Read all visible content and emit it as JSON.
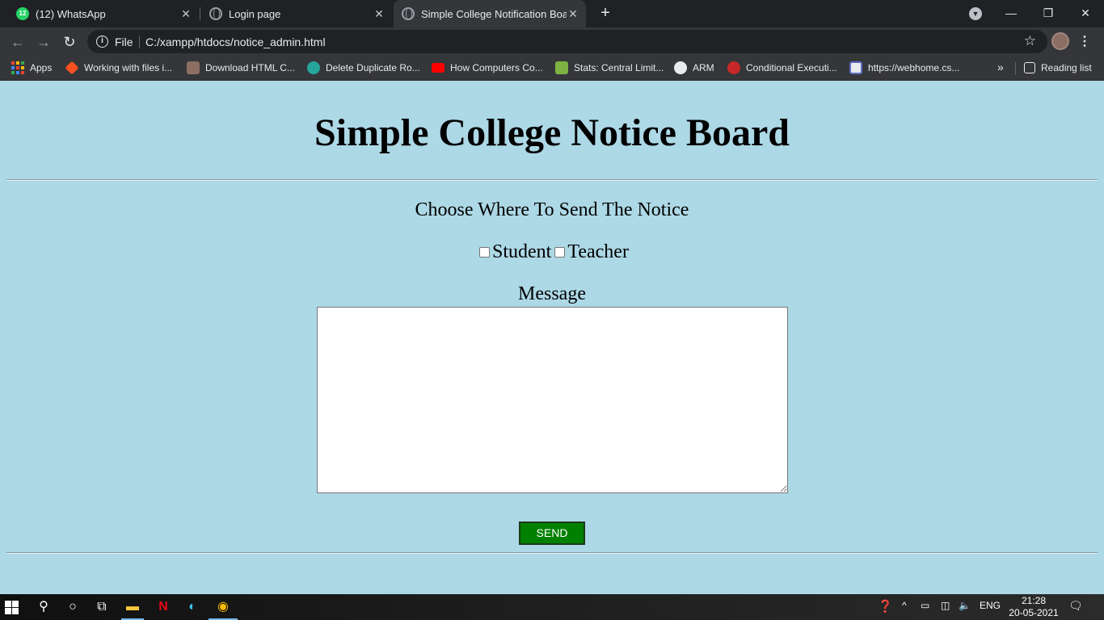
{
  "browser": {
    "tabs": [
      {
        "title": "(12) WhatsApp",
        "badge": "12"
      },
      {
        "title": "Login page"
      },
      {
        "title": "Simple College Notification Board"
      }
    ],
    "omnibox": {
      "scheme_label": "File",
      "url": "C:/xampp/htdocs/notice_admin.html"
    },
    "bookmarks": [
      {
        "label": "Apps"
      },
      {
        "label": "Working with files i..."
      },
      {
        "label": "Download HTML C..."
      },
      {
        "label": "Delete Duplicate Ro..."
      },
      {
        "label": "How Computers Co..."
      },
      {
        "label": "Stats: Central Limit..."
      },
      {
        "label": "ARM"
      },
      {
        "label": "Conditional Executi..."
      },
      {
        "label": "https://webhome.cs..."
      },
      {
        "label": "Reading list"
      }
    ],
    "overflow_glyph": "»"
  },
  "page": {
    "title": "Simple College Notice Board",
    "choose_label": "Choose Where To Send The Notice",
    "options": [
      {
        "label": "Student",
        "checked": false
      },
      {
        "label": "Teacher",
        "checked": false
      }
    ],
    "message_label": "Message",
    "message_value": "",
    "send_label": "SEND",
    "send_color": "#008000",
    "background_color": "#add8e6"
  },
  "taskbar": {
    "language": "ENG",
    "time": "21:28",
    "date": "20-05-2021"
  }
}
